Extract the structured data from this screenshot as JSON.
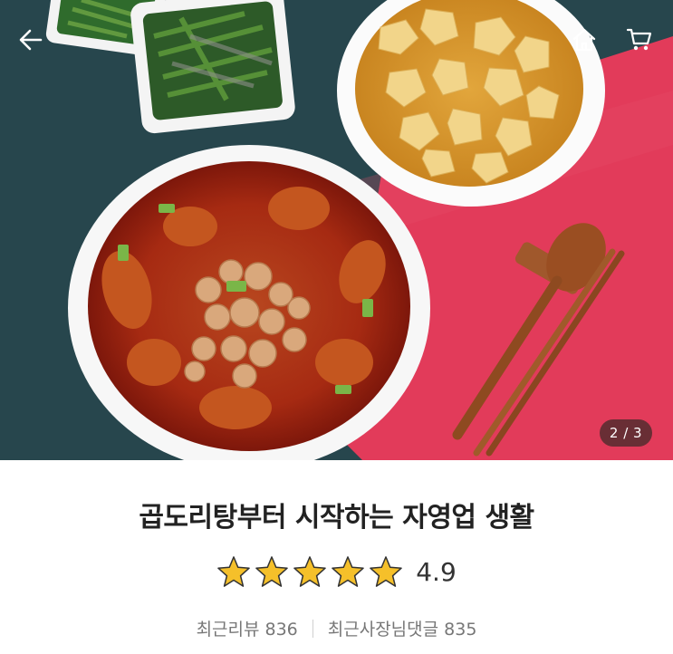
{
  "header": {
    "back_icon": "arrow-left-icon",
    "home_icon": "home-icon",
    "cart_icon": "cart-icon"
  },
  "gallery": {
    "counter": "2 / 3",
    "photo_colors": {
      "teal": "#27464d",
      "red": "#e23b5a"
    }
  },
  "store": {
    "title": "곱도리탕부터 시작하는 자영업 생활",
    "rating_value": "4.9",
    "star_count": 5,
    "star_color": "#f5c02a",
    "recent_reviews_label": "최근리뷰",
    "recent_reviews_count": "836",
    "owner_replies_label": "최근사장님댓글",
    "owner_replies_count": "835"
  }
}
